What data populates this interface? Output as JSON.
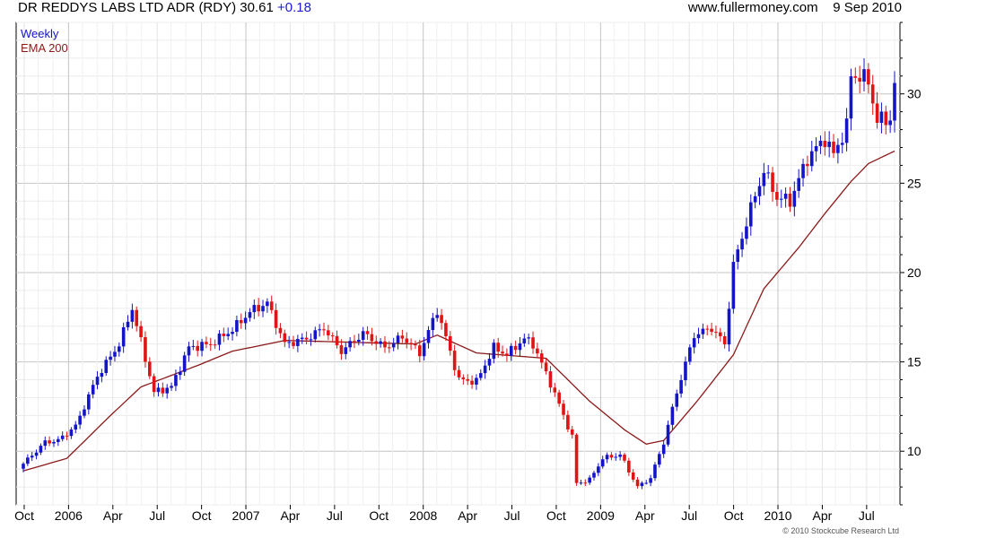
{
  "header": {
    "title": "DR REDDYS LABS LTD ADR (RDY) 30.61",
    "change": "+0.18",
    "site": "www.fullermoney.com",
    "date": "9 Sep 2010"
  },
  "copyright": "© 2010 Stockcube Research Ltd",
  "colors": {
    "up": "#1414c8",
    "down": "#e01414",
    "ema": "#8b1a1a",
    "grid": "#d8d8d8"
  },
  "chart_data": {
    "type": "candlestick",
    "legend": [
      {
        "label": "Weekly",
        "color": "#1414c8"
      },
      {
        "label": "EMA 200",
        "color": "#8b1a1a"
      }
    ],
    "ylim": [
      7,
      34
    ],
    "y_ticks": [
      10,
      15,
      20,
      25,
      30
    ],
    "x_tick_labels": [
      "Oct",
      "2006",
      "Apr",
      "Jul",
      "Oct",
      "2007",
      "Apr",
      "Jul",
      "Oct",
      "2008",
      "Apr",
      "Jul",
      "Oct",
      "2009",
      "Apr",
      "Jul",
      "Oct",
      "2010",
      "Apr",
      "Jul"
    ],
    "weekly_close_path": [
      [
        0,
        9.3
      ],
      [
        5,
        10.5
      ],
      [
        8,
        10.6
      ],
      [
        12,
        11.4
      ],
      [
        17,
        14.2
      ],
      [
        22,
        16.0
      ],
      [
        25,
        18.0
      ],
      [
        30,
        13.3
      ],
      [
        34,
        13.6
      ],
      [
        38,
        15.8
      ],
      [
        43,
        16.0
      ],
      [
        48,
        16.8
      ],
      [
        52,
        17.8
      ],
      [
        56,
        18.3
      ],
      [
        60,
        16.0
      ],
      [
        65,
        16.3
      ],
      [
        69,
        16.9
      ],
      [
        73,
        15.6
      ],
      [
        78,
        16.6
      ],
      [
        83,
        15.8
      ],
      [
        87,
        16.4
      ],
      [
        91,
        15.5
      ],
      [
        95,
        17.9
      ],
      [
        100,
        14.0
      ],
      [
        104,
        13.9
      ],
      [
        108,
        15.8
      ],
      [
        111,
        15.4
      ],
      [
        115,
        16.3
      ],
      [
        117,
        16.0
      ],
      [
        121,
        13.8
      ],
      [
        126,
        10.8
      ],
      [
        127,
        8.2
      ],
      [
        130,
        8.4
      ],
      [
        133,
        9.6
      ],
      [
        137,
        9.8
      ],
      [
        141,
        8.0
      ],
      [
        144,
        8.5
      ],
      [
        147,
        10.5
      ],
      [
        150,
        13.3
      ],
      [
        154,
        16.5
      ],
      [
        158,
        16.9
      ],
      [
        161,
        16.0
      ],
      [
        163,
        20.4
      ],
      [
        167,
        23.6
      ],
      [
        170,
        25.7
      ],
      [
        173,
        24.2
      ],
      [
        176,
        24.0
      ],
      [
        180,
        26.4
      ],
      [
        184,
        27.5
      ],
      [
        186,
        26.6
      ],
      [
        189,
        28.2
      ],
      [
        190,
        31.0
      ],
      [
        192,
        31.0
      ],
      [
        194,
        30.7
      ],
      [
        196,
        28.5
      ],
      [
        199,
        28.6
      ],
      [
        200,
        30.61
      ]
    ],
    "ema200_path": [
      [
        0,
        8.9
      ],
      [
        10,
        9.6
      ],
      [
        20,
        12.0
      ],
      [
        27,
        13.6
      ],
      [
        40,
        14.8
      ],
      [
        48,
        15.6
      ],
      [
        60,
        16.2
      ],
      [
        75,
        16.1
      ],
      [
        90,
        16.0
      ],
      [
        95,
        16.5
      ],
      [
        104,
        15.5
      ],
      [
        120,
        15.2
      ],
      [
        130,
        12.8
      ],
      [
        138,
        11.2
      ],
      [
        143,
        10.4
      ],
      [
        147,
        10.6
      ],
      [
        155,
        12.9
      ],
      [
        163,
        15.4
      ],
      [
        170,
        19.1
      ],
      [
        178,
        21.4
      ],
      [
        184,
        23.3
      ],
      [
        190,
        25.1
      ],
      [
        194,
        26.1
      ],
      [
        200,
        26.8
      ]
    ]
  }
}
